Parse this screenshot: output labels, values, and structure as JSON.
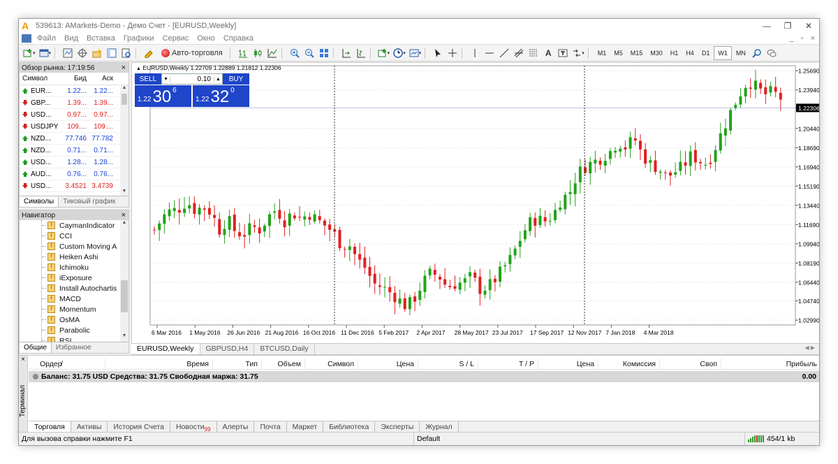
{
  "app": {
    "title": "539613: AMarkets-Demo - Демо Счет - [EURUSD,Weekly]",
    "window_controls": [
      "—",
      "❐",
      "✕"
    ]
  },
  "menu": {
    "items": [
      "Файл",
      "Вид",
      "Вставка",
      "Графики",
      "Сервис",
      "Окно",
      "Справка"
    ],
    "right": [
      "_",
      "▫",
      "×"
    ]
  },
  "toolbar": {
    "autotrading_label": "Авто-торговля",
    "timeframes": [
      "M1",
      "M5",
      "M15",
      "M30",
      "H1",
      "H4",
      "D1",
      "W1",
      "MN"
    ],
    "selected_timeframe": "W1",
    "text_tool": "A"
  },
  "market_watch": {
    "title": "Обзор рынка: 17:19:56",
    "headers": {
      "symbol": "Символ",
      "bid": "Бид",
      "ask": "Аск"
    },
    "rows": [
      {
        "symbol": "EUR...",
        "bid": "1.22...",
        "ask": "1.22...",
        "dir": "up",
        "color": "blue"
      },
      {
        "symbol": "GBP...",
        "bid": "1.39...",
        "ask": "1.39...",
        "dir": "down",
        "color": "red"
      },
      {
        "symbol": "USD...",
        "bid": "0.97...",
        "ask": "0.97...",
        "dir": "down",
        "color": "red"
      },
      {
        "symbol": "USDJPY",
        "bid": "109....",
        "ask": "109....",
        "dir": "down",
        "color": "red"
      },
      {
        "symbol": "NZD...",
        "bid": "77.746",
        "ask": "77.782",
        "dir": "up",
        "color": "blue"
      },
      {
        "symbol": "NZD...",
        "bid": "0.71...",
        "ask": "0.71...",
        "dir": "up",
        "color": "blue"
      },
      {
        "symbol": "USD...",
        "bid": "1.28...",
        "ask": "1.28...",
        "dir": "up",
        "color": "blue"
      },
      {
        "symbol": "AUD...",
        "bid": "0.76...",
        "ask": "0.76...",
        "dir": "up",
        "color": "blue"
      },
      {
        "symbol": "USD...",
        "bid": "3.4521",
        "ask": "3.4739",
        "dir": "down",
        "color": "red"
      }
    ],
    "tabs": [
      "Символы",
      "Тиковый график"
    ]
  },
  "navigator": {
    "title": "Навигатор",
    "items": [
      "CaymanIndicator",
      "CCI",
      "Custom Moving A",
      "Heiken Ashi",
      "Ichimoku",
      "iExposure",
      "Install Autochartis",
      "MACD",
      "Momentum",
      "OsMA",
      "Parabolic",
      "RSI"
    ],
    "tabs": [
      "Общие",
      "Избранное"
    ]
  },
  "chart": {
    "info": "EURUSD,Weekly  1.22709 1.22889 1.21812 1.22306",
    "sell_label": "SELL",
    "buy_label": "BUY",
    "lot": "0.10",
    "sell_price": {
      "prefix": "1.22",
      "big": "30",
      "sup": "6"
    },
    "buy_price": {
      "prefix": "1.22",
      "big": "32",
      "sup": "0"
    },
    "price_ticks": [
      "1.25690",
      "1.23940",
      "1.22306",
      "1.20440",
      "1.18690",
      "1.16940",
      "1.15190",
      "1.13440",
      "1.11690",
      "1.09940",
      "1.08190",
      "1.06440",
      "1.04740",
      "1.02990"
    ],
    "current_price": "1.22306",
    "date_ticks": [
      "6 Mar 2016",
      "1 May 2016",
      "26 Jun 2016",
      "21 Aug 2016",
      "16 Oct 2016",
      "11 Dec 2016",
      "5 Feb 2017",
      "2 Apr 2017",
      "28 May 2017",
      "23 Jul 2017",
      "17 Sep 2017",
      "12 Nov 2017",
      "7 Jan 2018",
      "4 Mar 2018"
    ],
    "colors": {
      "bull": "#22a31a",
      "bear": "#e02020",
      "grid": "#e4e4f0",
      "text": "#000000"
    }
  },
  "chart_tabs": [
    "EURUSD,Weekly",
    "GBPUSD,H4",
    "BTCUSD,Daily"
  ],
  "terminal": {
    "side_label": "Терминал",
    "headers": [
      "Ордер",
      "/",
      "Время",
      "Тип",
      "Объем",
      "Символ",
      "Цена",
      "S / L",
      "T / P",
      "Цена",
      "Комиссия",
      "Своп",
      "Прибыль"
    ],
    "balance_text": "Баланс: 31.75 USD  Средства: 31.75  Свободная маржа: 31.75",
    "balance_value": "0.00",
    "tabs": [
      "Торговля",
      "Активы",
      "История Счета",
      "Новости",
      "Алерты",
      "Почта",
      "Маркет",
      "Библиотека",
      "Эксперты",
      "Журнал"
    ],
    "news_count": "99"
  },
  "status": {
    "help": "Для вызова справки нажмите F1",
    "profile": "Default",
    "traffic": "454/1 kb"
  }
}
